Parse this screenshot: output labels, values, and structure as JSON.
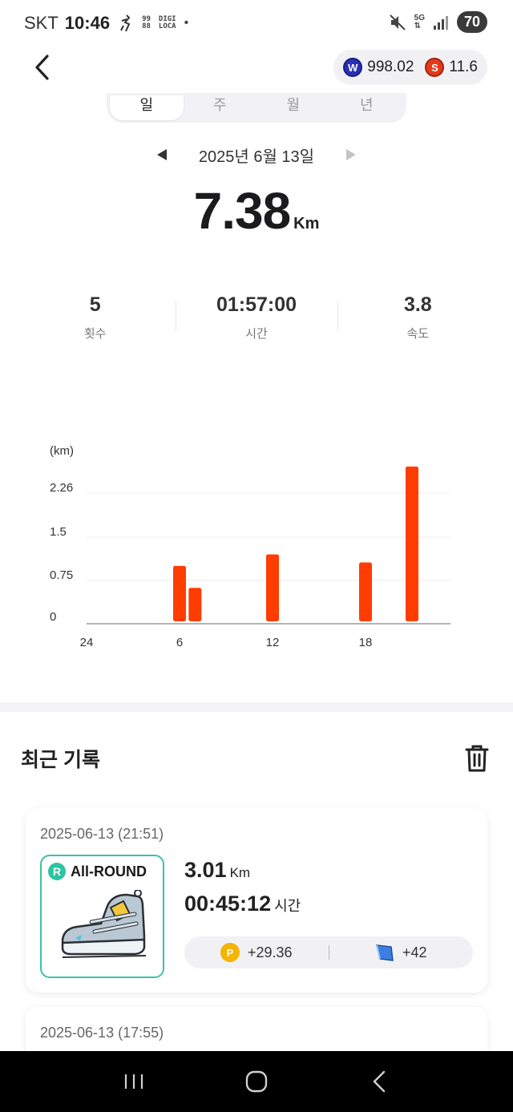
{
  "status_bar": {
    "carrier": "SKT",
    "time": "10:46",
    "mini_top": "99",
    "mini_bottom": "88",
    "digi_top": "DIGI",
    "digi_bottom": "LOCA",
    "dot": "•",
    "net": "5G",
    "battery": "70"
  },
  "balances": {
    "w_value": "998.02",
    "s_value": "11.6",
    "w_symbol": "W",
    "s_symbol": "S"
  },
  "tabs": [
    "일",
    "주",
    "월",
    "년"
  ],
  "date_nav": {
    "date": "2025년 6월 13일"
  },
  "summary": {
    "distance": "7.38",
    "unit": "Km"
  },
  "stats": [
    {
      "value": "5",
      "label": "횟수"
    },
    {
      "value": "01:57:00",
      "label": "시간"
    },
    {
      "value": "3.8",
      "label": "속도"
    }
  ],
  "chart_data": {
    "type": "bar",
    "ylabel": "(km)",
    "y_ticks": [
      "0",
      "0.75",
      "1.5",
      "2.26"
    ],
    "x_ticks": [
      "24",
      "6",
      "12",
      "18"
    ],
    "ylim": [
      0,
      2.26
    ],
    "x_unit": "hour",
    "bars": [
      {
        "hour": 6,
        "value": 1.0
      },
      {
        "hour": 7,
        "value": 0.62
      },
      {
        "hour": 12,
        "value": 1.2
      },
      {
        "hour": 18,
        "value": 1.06
      },
      {
        "hour": 21,
        "value": 2.72
      }
    ],
    "bar_color": "#ff3d00"
  },
  "records": {
    "title": "최근 기록",
    "items": [
      {
        "date": "2025-06-13 (21:51)",
        "shoe_badge": "R",
        "shoe_name": "All-ROUND",
        "distance": "3.01",
        "distance_unit": "Km",
        "duration": "00:45:12",
        "duration_unit": "시간",
        "point_symbol": "P",
        "points": "+29.36",
        "tiles": "+42"
      },
      {
        "date": "2025-06-13 (17:55)"
      }
    ]
  },
  "colors": {
    "accent": "#ff3d00",
    "teal": "#3cc3a7"
  }
}
